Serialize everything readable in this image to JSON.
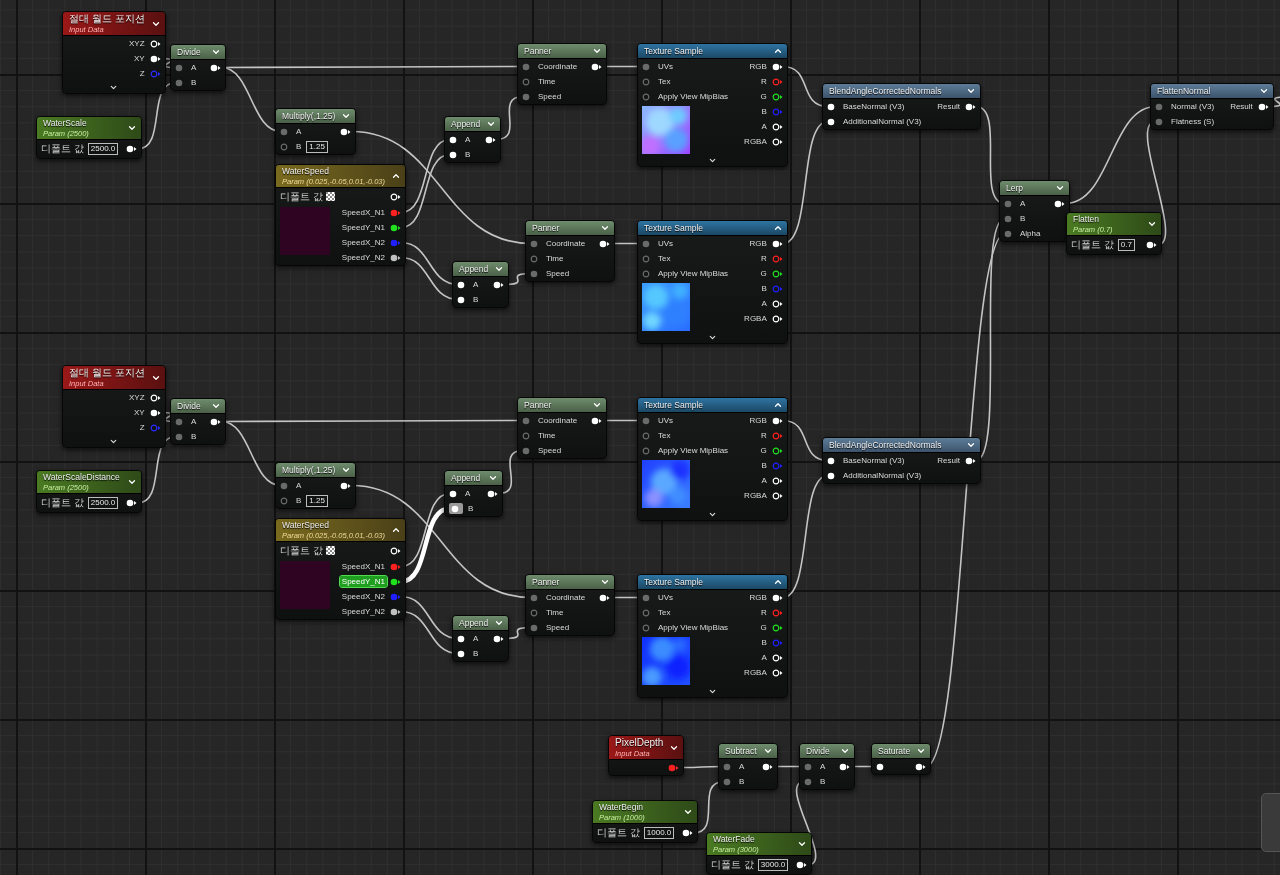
{
  "nodes": [
    {
      "kind": "input",
      "title": "절대 월드 포지션",
      "subtitle": "Input Data",
      "outputs": [
        {
          "label": "XYZ",
          "connected": false,
          "color": "#ffffff"
        },
        {
          "label": "XY",
          "connected": true,
          "color": "#ffffff"
        },
        {
          "label": "Z",
          "connected": false,
          "color": "#2a2aff"
        }
      ]
    },
    {
      "kind": "op",
      "title": "Divide",
      "inputs": [
        {
          "label": "A",
          "connected": true,
          "color": "#6a6a6a"
        },
        {
          "label": "B",
          "connected": true,
          "color": "#6a6a6a"
        }
      ],
      "outputs": [
        {
          "connected": true,
          "color": "#ffffff"
        }
      ]
    },
    {
      "kind": "param",
      "title": "WaterScale",
      "subtitle": "Param (2500)",
      "field_label": "디폴트 값",
      "value": "2500.0",
      "outputs": [
        {
          "connected": true,
          "color": "#ffffff"
        }
      ]
    },
    {
      "kind": "op",
      "title": "Multiply(,1.25)",
      "inputs": [
        {
          "label": "A",
          "connected": true,
          "color": "#6a6a6a"
        },
        {
          "label": "B",
          "connected": false,
          "color": "#6a6a6a",
          "value": "1.25"
        }
      ],
      "outputs": [
        {
          "connected": true,
          "color": "#ffffff"
        }
      ]
    },
    {
      "kind": "vector_param",
      "title": "WaterSpeed",
      "subtitle": "Param (0.025,-0.05,0.01,-0.03)",
      "field_label": "디폴트 값",
      "outputs": [
        {
          "connected": false,
          "color": "#ffffff",
          "highlighted": false
        },
        {
          "label": "SpeedX_N1",
          "connected": true,
          "color": "#ff2020",
          "highlighted": false
        },
        {
          "label": "SpeedY_N1",
          "connected": true,
          "color": "#20e020",
          "highlighted": false
        },
        {
          "label": "SpeedX_N2",
          "connected": true,
          "color": "#2020ff",
          "highlighted": false
        },
        {
          "label": "SpeedY_N2",
          "connected": true,
          "color": "#c0c0c0",
          "highlighted": false
        }
      ]
    },
    {
      "kind": "op",
      "title": "Append",
      "inputs": [
        {
          "label": "A",
          "connected": true,
          "color": "#ffffff",
          "highlighted": false
        },
        {
          "label": "B",
          "connected": true,
          "color": "#ffffff",
          "highlighted": false
        }
      ],
      "outputs": [
        {
          "connected": true,
          "color": "#ffffff"
        }
      ]
    },
    {
      "kind": "op",
      "title": "Append",
      "inputs": [
        {
          "label": "A",
          "connected": true,
          "color": "#ffffff",
          "highlighted": false
        },
        {
          "label": "B",
          "connected": true,
          "color": "#ffffff",
          "highlighted": false
        }
      ],
      "outputs": [
        {
          "connected": true,
          "color": "#ffffff"
        }
      ]
    },
    {
      "kind": "op",
      "title": "Panner",
      "inputs": [
        {
          "label": "Coordinate",
          "connected": true,
          "color": "#6a6a6a"
        },
        {
          "label": "Time",
          "connected": false,
          "color": "#6a6a6a"
        },
        {
          "label": "Speed",
          "connected": true,
          "color": "#6a6a6a"
        }
      ],
      "outputs": [
        {
          "connected": true,
          "color": "#ffffff"
        }
      ]
    },
    {
      "kind": "op",
      "title": "Panner",
      "inputs": [
        {
          "label": "Coordinate",
          "connected": true,
          "color": "#6a6a6a"
        },
        {
          "label": "Time",
          "connected": false,
          "color": "#6a6a6a"
        },
        {
          "label": "Speed",
          "connected": true,
          "color": "#6a6a6a"
        }
      ],
      "outputs": [
        {
          "connected": true,
          "color": "#ffffff"
        }
      ]
    },
    {
      "kind": "texture",
      "title": "Texture Sample",
      "inputs": [
        {
          "label": "UVs",
          "connected": true,
          "color": "#6a6a6a"
        },
        {
          "label": "Tex",
          "connected": false,
          "color": "#6a6a6a"
        },
        {
          "label": "Apply View MipBias",
          "connected": false,
          "color": "#6a6a6a"
        }
      ],
      "outputs": [
        {
          "label": "RGB",
          "connected": true,
          "color": "#ffffff"
        },
        {
          "label": "R",
          "connected": false,
          "color": "#ff2020"
        },
        {
          "label": "G",
          "connected": false,
          "color": "#20e020"
        },
        {
          "label": "B",
          "connected": false,
          "color": "#2020ff"
        },
        {
          "label": "A",
          "connected": false,
          "color": "#ffffff"
        },
        {
          "label": "RGBA",
          "connected": false,
          "color": "#ffffff"
        }
      ]
    },
    {
      "kind": "texture",
      "title": "Texture Sample",
      "inputs": [
        {
          "label": "UVs",
          "connected": true,
          "color": "#6a6a6a"
        },
        {
          "label": "Tex",
          "connected": false,
          "color": "#6a6a6a"
        },
        {
          "label": "Apply View MipBias",
          "connected": false,
          "color": "#6a6a6a"
        }
      ],
      "outputs": [
        {
          "label": "RGB",
          "connected": true,
          "color": "#ffffff"
        },
        {
          "label": "R",
          "connected": false,
          "color": "#ff2020"
        },
        {
          "label": "G",
          "connected": false,
          "color": "#20e020"
        },
        {
          "label": "B",
          "connected": false,
          "color": "#2020ff"
        },
        {
          "label": "A",
          "connected": false,
          "color": "#ffffff"
        },
        {
          "label": "RGBA",
          "connected": false,
          "color": "#ffffff"
        }
      ]
    },
    {
      "kind": "function",
      "title": "BlendAngleCorrectedNormals",
      "inputs": [
        {
          "label": "BaseNormal (V3)",
          "connected": true,
          "color": "#ffffff"
        },
        {
          "label": "AdditionalNormal (V3)",
          "connected": true,
          "color": "#ffffff"
        }
      ],
      "outputs": [
        {
          "label": "Result",
          "connected": true,
          "color": "#ffffff"
        }
      ]
    },
    {
      "kind": "input",
      "title": "절대 월드 포지션",
      "subtitle": "Input Data",
      "outputs": [
        {
          "label": "XYZ",
          "connected": false,
          "color": "#ffffff"
        },
        {
          "label": "XY",
          "connected": true,
          "color": "#ffffff"
        },
        {
          "label": "Z",
          "connected": false,
          "color": "#2a2aff"
        }
      ]
    },
    {
      "kind": "op",
      "title": "Divide",
      "inputs": [
        {
          "label": "A",
          "connected": true,
          "color": "#6a6a6a"
        },
        {
          "label": "B",
          "connected": true,
          "color": "#6a6a6a"
        }
      ],
      "outputs": [
        {
          "connected": true,
          "color": "#ffffff"
        }
      ]
    },
    {
      "kind": "param",
      "title": "WaterScaleDistance",
      "subtitle": "Param (2500)",
      "field_label": "디폴트 값",
      "value": "2500.0",
      "outputs": [
        {
          "connected": true,
          "color": "#ffffff"
        }
      ]
    },
    {
      "kind": "op",
      "title": "Multiply(,1.25)",
      "inputs": [
        {
          "label": "A",
          "connected": true,
          "color": "#6a6a6a"
        },
        {
          "label": "B",
          "connected": false,
          "color": "#6a6a6a",
          "value": "1.25"
        }
      ],
      "outputs": [
        {
          "connected": true,
          "color": "#ffffff"
        }
      ]
    },
    {
      "kind": "vector_param",
      "title": "WaterSpeed",
      "subtitle": "Param (0.025,-0.05,0.01,-0.03)",
      "field_label": "디폴트 값",
      "outputs": [
        {
          "connected": false,
          "color": "#ffffff",
          "highlighted": false
        },
        {
          "label": "SpeedX_N1",
          "connected": true,
          "color": "#ff2020",
          "highlighted": false
        },
        {
          "label": "SpeedY_N1",
          "connected": true,
          "color": "#20e020",
          "highlighted": true
        },
        {
          "label": "SpeedX_N2",
          "connected": true,
          "color": "#2020ff",
          "highlighted": false
        },
        {
          "label": "SpeedY_N2",
          "connected": true,
          "color": "#c0c0c0",
          "highlighted": false
        }
      ]
    },
    {
      "kind": "op",
      "title": "Append",
      "inputs": [
        {
          "label": "A",
          "connected": true,
          "color": "#ffffff",
          "highlighted": false
        },
        {
          "label": "B",
          "connected": true,
          "color": "#ffffff",
          "highlighted": true
        }
      ],
      "outputs": [
        {
          "connected": true,
          "color": "#ffffff"
        }
      ]
    },
    {
      "kind": "op",
      "title": "Append",
      "inputs": [
        {
          "label": "A",
          "connected": true,
          "color": "#ffffff",
          "highlighted": false
        },
        {
          "label": "B",
          "connected": true,
          "color": "#ffffff",
          "highlighted": false
        }
      ],
      "outputs": [
        {
          "connected": true,
          "color": "#ffffff"
        }
      ]
    },
    {
      "kind": "op",
      "title": "Panner",
      "inputs": [
        {
          "label": "Coordinate",
          "connected": true,
          "color": "#6a6a6a"
        },
        {
          "label": "Time",
          "connected": false,
          "color": "#6a6a6a"
        },
        {
          "label": "Speed",
          "connected": true,
          "color": "#6a6a6a"
        }
      ],
      "outputs": [
        {
          "connected": true,
          "color": "#ffffff"
        }
      ]
    },
    {
      "kind": "op",
      "title": "Panner",
      "inputs": [
        {
          "label": "Coordinate",
          "connected": true,
          "color": "#6a6a6a"
        },
        {
          "label": "Time",
          "connected": false,
          "color": "#6a6a6a"
        },
        {
          "label": "Speed",
          "connected": true,
          "color": "#6a6a6a"
        }
      ],
      "outputs": [
        {
          "connected": true,
          "color": "#ffffff"
        }
      ]
    },
    {
      "kind": "texture",
      "title": "Texture Sample",
      "inputs": [
        {
          "label": "UVs",
          "connected": true,
          "color": "#6a6a6a"
        },
        {
          "label": "Tex",
          "connected": false,
          "color": "#6a6a6a"
        },
        {
          "label": "Apply View MipBias",
          "connected": false,
          "color": "#6a6a6a"
        }
      ],
      "outputs": [
        {
          "label": "RGB",
          "connected": true,
          "color": "#ffffff"
        },
        {
          "label": "R",
          "connected": false,
          "color": "#ff2020"
        },
        {
          "label": "G",
          "connected": false,
          "color": "#20e020"
        },
        {
          "label": "B",
          "connected": false,
          "color": "#2020ff"
        },
        {
          "label": "A",
          "connected": false,
          "color": "#ffffff"
        },
        {
          "label": "RGBA",
          "connected": false,
          "color": "#ffffff"
        }
      ]
    },
    {
      "kind": "texture",
      "title": "Texture Sample",
      "inputs": [
        {
          "label": "UVs",
          "connected": true,
          "color": "#6a6a6a"
        },
        {
          "label": "Tex",
          "connected": false,
          "color": "#6a6a6a"
        },
        {
          "label": "Apply View MipBias",
          "connected": false,
          "color": "#6a6a6a"
        }
      ],
      "outputs": [
        {
          "label": "RGB",
          "connected": true,
          "color": "#ffffff"
        },
        {
          "label": "R",
          "connected": false,
          "color": "#ff2020"
        },
        {
          "label": "G",
          "connected": false,
          "color": "#20e020"
        },
        {
          "label": "B",
          "connected": false,
          "color": "#2020ff"
        },
        {
          "label": "A",
          "connected": false,
          "color": "#ffffff"
        },
        {
          "label": "RGBA",
          "connected": false,
          "color": "#ffffff"
        }
      ]
    },
    {
      "kind": "function",
      "title": "BlendAngleCorrectedNormals",
      "inputs": [
        {
          "label": "BaseNormal (V3)",
          "connected": true,
          "color": "#ffffff"
        },
        {
          "label": "AdditionalNormal (V3)",
          "connected": true,
          "color": "#ffffff"
        }
      ],
      "outputs": [
        {
          "label": "Result",
          "connected": true,
          "color": "#ffffff"
        }
      ]
    },
    {
      "kind": "op",
      "title": "Lerp",
      "inputs": [
        {
          "label": "A",
          "connected": true,
          "color": "#6a6a6a"
        },
        {
          "label": "B",
          "connected": true,
          "color": "#6a6a6a"
        },
        {
          "label": "Alpha",
          "connected": true,
          "color": "#6a6a6a"
        }
      ],
      "outputs": [
        {
          "connected": true,
          "color": "#ffffff"
        }
      ]
    },
    {
      "kind": "param",
      "title": "Flatten",
      "subtitle": "Param (0.7)",
      "field_label": "디폴트 값",
      "value": "0.7",
      "outputs": [
        {
          "connected": true,
          "color": "#ffffff"
        }
      ]
    },
    {
      "kind": "function",
      "title": "FlattenNormal",
      "inputs": [
        {
          "label": "Normal (V3)",
          "connected": true,
          "color": "#6a6a6a"
        },
        {
          "label": "Flatness (S)",
          "connected": true,
          "color": "#6a6a6a"
        }
      ],
      "outputs": [
        {
          "label": "Result",
          "connected": true,
          "color": "#ffffff"
        }
      ]
    },
    {
      "kind": "input",
      "title": "PixelDepth",
      "subtitle": "Input Data",
      "outputs": [
        {
          "connected": true,
          "color": "#ff2020"
        }
      ]
    },
    {
      "kind": "op",
      "title": "Subtract",
      "inputs": [
        {
          "label": "A",
          "connected": true,
          "color": "#6a6a6a"
        },
        {
          "label": "B",
          "connected": true,
          "color": "#6a6a6a"
        }
      ],
      "outputs": [
        {
          "connected": true,
          "color": "#ffffff"
        }
      ]
    },
    {
      "kind": "op",
      "title": "Divide",
      "inputs": [
        {
          "label": "A",
          "connected": true,
          "color": "#6a6a6a"
        },
        {
          "label": "B",
          "connected": true,
          "color": "#6a6a6a"
        }
      ],
      "outputs": [
        {
          "connected": true,
          "color": "#ffffff"
        }
      ]
    },
    {
      "kind": "op",
      "title": "Saturate",
      "inputs": [
        {
          "connected": true,
          "color": "#ffffff"
        }
      ],
      "outputs": [
        {
          "connected": true,
          "color": "#ffffff"
        }
      ]
    },
    {
      "kind": "param",
      "title": "WaterBegin",
      "subtitle": "Param (1000)",
      "field_label": "디폴트 값",
      "value": "1000.0",
      "outputs": [
        {
          "connected": true,
          "color": "#ffffff"
        }
      ]
    },
    {
      "kind": "param",
      "title": "WaterFade",
      "subtitle": "Param (3000)",
      "field_label": "디폴트 값",
      "value": "3000.0",
      "outputs": [
        {
          "connected": true,
          "color": "#ffffff"
        }
      ]
    }
  ]
}
